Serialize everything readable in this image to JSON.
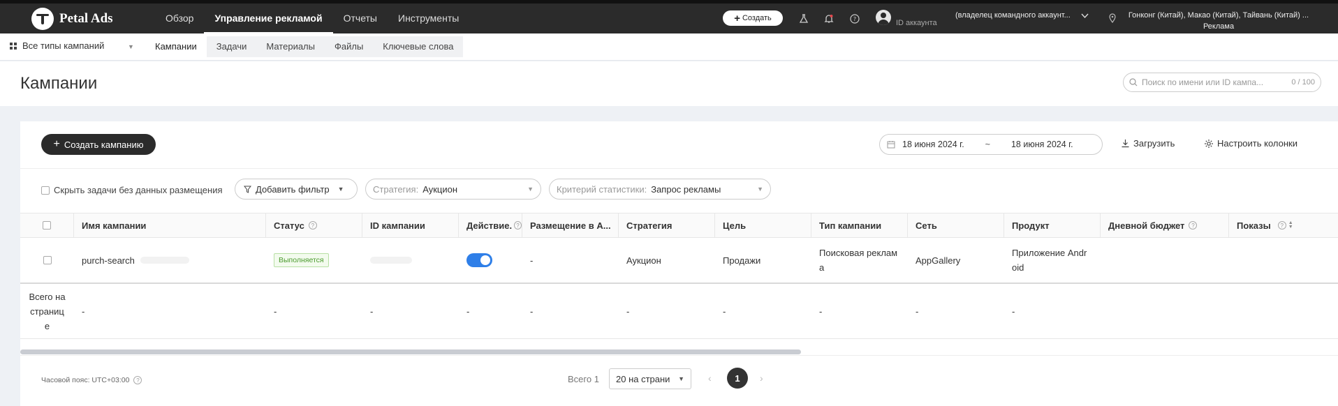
{
  "topbar": {
    "brand": "Petal Ads",
    "nav": [
      "Обзор",
      "Управление рекламой",
      "Отчеты",
      "Инструменты"
    ],
    "active_nav": 1,
    "create_label": "Создать",
    "account_id": "ID аккаунта",
    "owner": "(владелец командного аккаунт...",
    "region_line1": "Гонконг (Китай), Макао (Китай), Тайвань (Китай) ...",
    "region_line2": "Реклама"
  },
  "subnav": {
    "campaign_type": "Все типы кампаний",
    "tabs": [
      "Кампании",
      "Задачи",
      "Материалы",
      "Файлы",
      "Ключевые слова"
    ],
    "active_tab": 0
  },
  "page": {
    "title": "Кампании",
    "search_placeholder": "Поиск по имени или ID кампа...",
    "search_count": "0 / 100"
  },
  "toolbar": {
    "create_campaign": "Создать кампанию",
    "date_from": "18 июня 2024 г.",
    "date_sep": "~",
    "date_to": "18 июня 2024 г.",
    "download": "Загрузить",
    "columns": "Настроить колонки"
  },
  "filters": {
    "hide_tasks": "Скрыть задачи без данных размещения",
    "add_filter": "Добавить фильтр",
    "strategy_label": "Стратегия:",
    "strategy_value": "Аукцион",
    "stat_label": "Критерий статистики:",
    "stat_value": "Запрос рекламы"
  },
  "table": {
    "headers": {
      "name": "Имя кампании",
      "status": "Статус",
      "id": "ID кампании",
      "action": "Действие...",
      "placement": "Размещение в А...",
      "strategy": "Стратегия",
      "goal": "Цель",
      "type": "Тип кампании",
      "network": "Сеть",
      "product": "Продукт",
      "budget": "Дневной бюджет",
      "impressions": "Показы"
    },
    "row": {
      "name": "purch-search",
      "status": "Выполняется",
      "placement": "-",
      "strategy": "Аукцион",
      "goal": "Продажи",
      "type": "Поисковая реклам\nа",
      "network": "AppGallery",
      "product": "Приложение Andr\noid",
      "toggle_on": true
    },
    "total": {
      "label": "Всего на\nстраниц\nе",
      "dash": "-"
    }
  },
  "footer": {
    "timezone": "Часовой пояс: UTC+03:00",
    "total": "Всего 1",
    "per_page": "20 на страни",
    "current_page": "1"
  }
}
